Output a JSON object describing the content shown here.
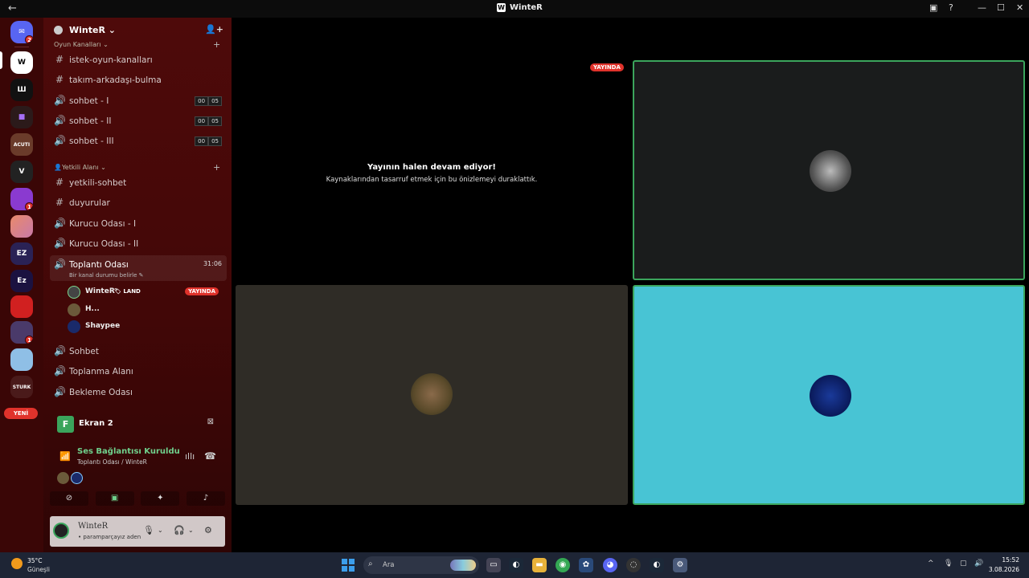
{
  "window": {
    "title": "WinteR",
    "back": "←",
    "forward": "→"
  },
  "rail": {
    "home_badge": "2",
    "badges": [
      "1",
      "1",
      "1"
    ],
    "new_label": "YENİ",
    "server_initials": [
      "W",
      "Ш",
      "",
      "ACUTI",
      "V",
      "",
      "",
      "EZ",
      "Ez",
      "",
      "",
      "",
      "STURK"
    ]
  },
  "guild": {
    "name": "WinteR ⌄"
  },
  "categories": {
    "oyun": "Oyun Kanalları ⌄",
    "yetkili": "👤Yetkili Alanı ⌄"
  },
  "channels": [
    {
      "icon": "#",
      "name": "istek-oyun-kanalları"
    },
    {
      "icon": "#",
      "name": "takım-arkadaşı-bulma"
    },
    {
      "icon": "🔊",
      "name": "sohbet - I",
      "a": "00",
      "b": "05"
    },
    {
      "icon": "🔊",
      "name": "sohbet - II",
      "a": "00",
      "b": "05"
    },
    {
      "icon": "🔊",
      "name": "sohbet - III",
      "a": "00",
      "b": "05"
    },
    {
      "icon": "#",
      "name": "yetkili-sohbet"
    },
    {
      "icon": "#",
      "name": "duyurular"
    },
    {
      "icon": "🔊",
      "name": "Kurucu Odası - I"
    },
    {
      "icon": "🔊",
      "name": "Kurucu Odası - II"
    }
  ],
  "active_channel": {
    "name": "Toplantı Odası",
    "timer": "31:06",
    "status": "Bir kanal durumu belirle ✎"
  },
  "voice_users": [
    {
      "name": "WinteR",
      "tag": "🏷 LAND",
      "live": "YAYINDA"
    },
    {
      "name": "H...",
      "tag": "",
      "live": ""
    },
    {
      "name": "Shaypee",
      "tag": "",
      "live": ""
    }
  ],
  "more_channels": [
    {
      "icon": "🔊",
      "name": "Sohbet"
    },
    {
      "icon": "🔊",
      "name": "Toplanma Alanı"
    },
    {
      "icon": "🔊",
      "name": "Bekleme Odası"
    }
  ],
  "screen_share": {
    "label": "Ekran 2",
    "icon": "F"
  },
  "voice_status": {
    "title": "Ses Bağlantısı Kuruldu",
    "sub": "Toplantı Odası / WinteR"
  },
  "user": {
    "name": "WinteR",
    "status": "• paramparçayız aden"
  },
  "stage": {
    "live_tag": "YAYINDA",
    "paused_title": "Yayının halen devam ediyor!",
    "paused_sub": "Kaynaklarından tasarruf etmek için bu önizlemeyi duraklattık."
  },
  "taskbar": {
    "temp": "35°C",
    "condition": "Güneşli",
    "search": "Ara",
    "time": "15:52",
    "date": "3.08.2026"
  },
  "colors": {
    "accent_green": "#3ba55c",
    "live_red": "#e0322b",
    "sidebar": "#4e0a0a"
  }
}
